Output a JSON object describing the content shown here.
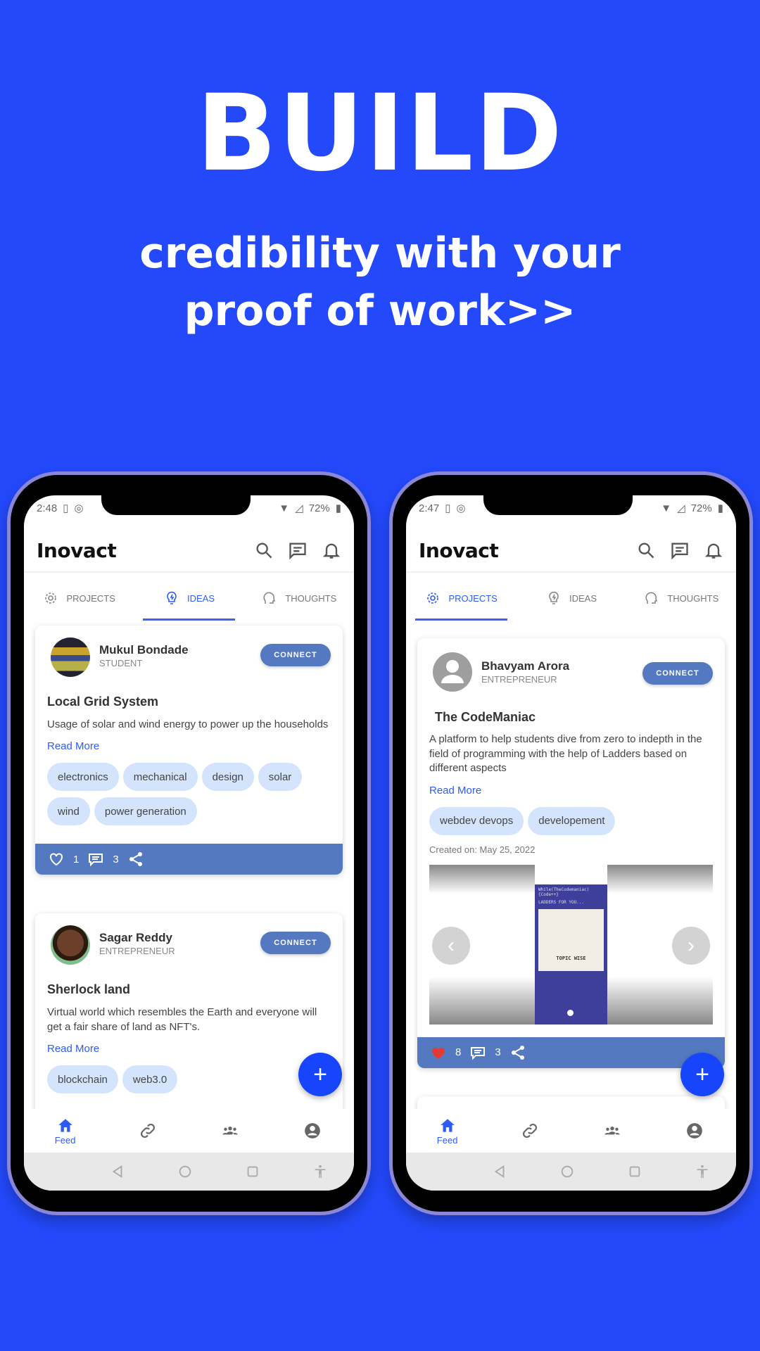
{
  "headline": {
    "title": "BUILD",
    "line1": "credibility with your",
    "line2": "proof of work>>"
  },
  "colors": {
    "background": "#2349fb",
    "accent": "#2d5cf5",
    "card_footer": "#5479c0",
    "chip": "#d5e4fd",
    "fab": "#1745fb",
    "liked": "#e53935"
  },
  "phones": [
    {
      "status": {
        "time": "2:48",
        "battery": "72%"
      },
      "app_title": "Inovact",
      "tabs": [
        {
          "label": "PROJECTS",
          "icon": "gear-icon"
        },
        {
          "label": "IDEAS",
          "icon": "lightbulb-icon"
        },
        {
          "label": "THOUGHTS",
          "icon": "head-icon"
        }
      ],
      "active_tab": "IDEAS",
      "cards": [
        {
          "name": "Mukul Bondade",
          "role": "STUDENT",
          "connect": "CONNECT",
          "title": "Local Grid System",
          "description": "Usage of solar and wind energy to power up the households",
          "read_more": "Read More",
          "tags": [
            "electronics",
            "mechanical",
            "design",
            "solar",
            "wind",
            "power generation"
          ],
          "likes": "1",
          "liked": false,
          "comments": "3"
        },
        {
          "name": "Sagar Reddy",
          "role": "ENTREPRENEUR",
          "connect": "CONNECT",
          "title": "Sherlock land",
          "description": "Virtual world which resembles the Earth and everyone will get a fair share of land as NFT's.",
          "read_more": "Read More",
          "tags": [
            "blockchain",
            "web3.0"
          ]
        }
      ],
      "fab": "+",
      "nav": {
        "feed_label": "Feed"
      }
    },
    {
      "status": {
        "time": "2:47",
        "battery": "72%"
      },
      "app_title": "Inovact",
      "tabs": [
        {
          "label": "PROJECTS",
          "icon": "gear-icon"
        },
        {
          "label": "IDEAS",
          "icon": "lightbulb-icon"
        },
        {
          "label": "THOUGHTS",
          "icon": "head-icon"
        }
      ],
      "active_tab": "PROJECTS",
      "cards": [
        {
          "name": "Bhavyam Arora",
          "role": "ENTREPRENEUR",
          "connect": "CONNECT",
          "title": "The CodeManiac",
          "description": "A platform to help students dive from zero to indepth in the field of programming with the help of Ladders based on different aspects",
          "read_more": "Read More",
          "tags": [
            "webdev devops",
            "developement"
          ],
          "created": "Created on: May 25, 2022",
          "image": {
            "line1": "While(TheCodemaniac)",
            "line2": "{Code++}",
            "line3": "LADDERS FOR YOU...",
            "tile": "TOPIC WISE"
          },
          "likes": "8",
          "liked": true,
          "comments": "3"
        }
      ],
      "fab": "+",
      "nav": {
        "feed_label": "Feed"
      }
    }
  ]
}
